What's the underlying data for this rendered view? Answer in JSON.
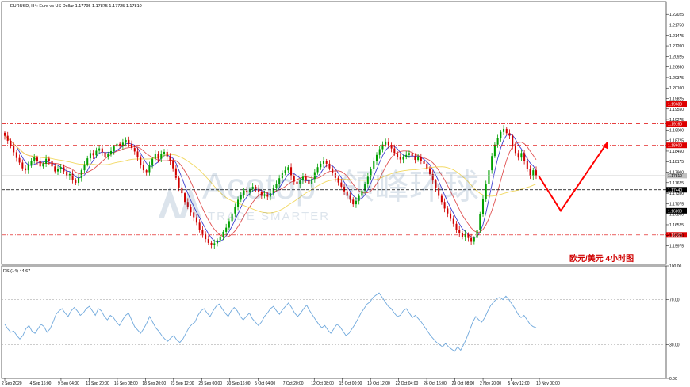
{
  "header": {
    "symbol_line": "EURUSD, H4:  Euro vs US Dollar  1.17795 1.17875 1.17725 1.17810"
  },
  "watermark": {
    "brand": "Acetop",
    "brand_cn": "领峰环球",
    "tagline": "TRADE SMARTER"
  },
  "annotation": "欧元/美元   4小时图",
  "colors": {
    "bull": "#00a000",
    "bear": "#d00000",
    "ma_fast": "#3f3fd0",
    "ma_mid": "#e05050",
    "ma_slow": "#f2d860",
    "rsi": "#6fa8dc",
    "level_red": "#dd0000",
    "level_black": "#000000",
    "arrow": "#ff0000"
  },
  "chart_data": [
    {
      "type": "candlestick",
      "name": "price",
      "ylim": [
        1.1549,
        1.2236
      ],
      "ytick_labels": [
        "1.22025",
        "1.21750",
        "1.21475",
        "1.21200",
        "1.20925",
        "1.20650",
        "1.20375",
        "1.20100",
        "1.19825",
        "1.19550",
        "1.19275",
        "1.19000",
        "1.18725",
        "1.18450",
        "1.18175",
        "1.17900",
        "1.17625",
        "1.17350",
        "1.17075",
        "1.16800",
        "1.16525",
        "1.16250",
        "1.15975"
      ],
      "ytick_values": [
        1.22025,
        1.2175,
        1.21475,
        1.212,
        1.20925,
        1.2065,
        1.20375,
        1.201,
        1.19825,
        1.1955,
        1.19275,
        1.19,
        1.18725,
        1.1845,
        1.18175,
        1.179,
        1.17625,
        1.1735,
        1.17075,
        1.168,
        1.16525,
        1.1625,
        1.15975
      ],
      "current_price": 1.1781,
      "current_price_label": "1.17810",
      "levels": [
        {
          "value": 1.1968,
          "label": "1.19680",
          "style": "red"
        },
        {
          "value": 1.1916,
          "label": "1.19160",
          "style": "red"
        },
        {
          "value": 1.186,
          "label": "1.18600",
          "style": "red"
        },
        {
          "value": 1.1744,
          "label": "1.17440",
          "style": "black"
        },
        {
          "value": 1.1689,
          "label": "1.16890",
          "style": "black"
        },
        {
          "value": 1.1626,
          "label": "1.16260",
          "style": "red"
        }
      ],
      "closes": [
        1.1885,
        1.1872,
        1.1858,
        1.1842,
        1.1827,
        1.1815,
        1.18,
        1.1795,
        1.1808,
        1.182,
        1.1828,
        1.1818,
        1.1805,
        1.1812,
        1.1825,
        1.1818,
        1.1805,
        1.1792,
        1.1798,
        1.1803,
        1.1792,
        1.178,
        1.1785,
        1.177,
        1.1762,
        1.1775,
        1.1795,
        1.181,
        1.1826,
        1.184,
        1.1834,
        1.1846,
        1.1852,
        1.1842,
        1.183,
        1.1838,
        1.1845,
        1.1857,
        1.1864,
        1.1858,
        1.1867,
        1.1874,
        1.1864,
        1.1853,
        1.1844,
        1.1828,
        1.1808,
        1.1795,
        1.179,
        1.1807,
        1.1825,
        1.1838,
        1.1825,
        1.1837,
        1.1843,
        1.1831,
        1.1818,
        1.18,
        1.1775,
        1.175,
        1.1735,
        1.1712,
        1.17,
        1.1685,
        1.1672,
        1.1658,
        1.164,
        1.1628,
        1.1615,
        1.1605,
        1.16,
        1.1604,
        1.1612,
        1.1622,
        1.1634,
        1.1645,
        1.1662,
        1.1682,
        1.17,
        1.1718,
        1.173,
        1.1742,
        1.1737,
        1.1745,
        1.1752,
        1.1746,
        1.1738,
        1.1728,
        1.1732,
        1.1726,
        1.1735,
        1.1748,
        1.176,
        1.1774,
        1.1788,
        1.1795,
        1.1803,
        1.178,
        1.1765,
        1.1758,
        1.1768,
        1.1778,
        1.177,
        1.176,
        1.1772,
        1.179,
        1.1803,
        1.1812,
        1.182,
        1.1812,
        1.18,
        1.1788,
        1.1775,
        1.1763,
        1.1752,
        1.174,
        1.1728,
        1.1718,
        1.1706,
        1.1715,
        1.1728,
        1.1742,
        1.176,
        1.1778,
        1.1798,
        1.1818,
        1.1835,
        1.185,
        1.1862,
        1.187,
        1.1861,
        1.1852,
        1.184,
        1.183,
        1.1823,
        1.183,
        1.1835,
        1.184,
        1.1832,
        1.1822,
        1.183,
        1.182,
        1.1812,
        1.18,
        1.1785,
        1.1768,
        1.1748,
        1.1728,
        1.1712,
        1.1695,
        1.1682,
        1.1668,
        1.1655,
        1.164,
        1.163,
        1.162,
        1.1628,
        1.1618,
        1.1608,
        1.1618,
        1.164,
        1.168,
        1.172,
        1.176,
        1.1795,
        1.1832,
        1.1862,
        1.188,
        1.1895,
        1.1903,
        1.1892,
        1.1885,
        1.186,
        1.184,
        1.1828,
        1.184,
        1.182,
        1.1798,
        1.178,
        1.1795,
        1.1781
      ],
      "x_tick_labels": [
        "2 Sep 2020",
        "4 Sep 16:00",
        "9 Sep 04:00",
        "11 Sep 20:00",
        "16 Sep 08:00",
        "18 Sep 20:00",
        "23 Sep 12:00",
        "28 Sep 00:00",
        "30 Sep 16:00",
        "5 Oct 04:00",
        "7 Oct 20:00",
        "12 Oct 08:00",
        "15 Oct 00:00",
        "19 Oct 12:00",
        "22 Oct 04:00",
        "26 Oct 16:00",
        "29 Oct 08:00",
        "2 Nov 20:00",
        "5 Nov 12:00",
        "10 Nov 00:00"
      ]
    },
    {
      "type": "line",
      "name": "RSI(14)",
      "label": "RSI(14) 44.67",
      "ylim": [
        0,
        100
      ],
      "ytick_labels": [
        "100.00",
        "70.00",
        "30.00",
        "0.00"
      ],
      "ytick_values": [
        100,
        70,
        30,
        0
      ],
      "levels": [
        70,
        30
      ],
      "values": [
        48,
        44,
        41,
        42,
        38,
        35,
        38,
        44,
        47,
        42,
        40,
        44,
        48,
        46,
        41,
        44,
        50,
        57,
        60,
        62,
        58,
        55,
        60,
        63,
        60,
        56,
        58,
        62,
        64,
        60,
        56,
        62,
        60,
        55,
        52,
        56,
        54,
        50,
        47,
        52,
        56,
        58,
        52,
        46,
        43,
        40,
        44,
        49,
        55,
        50,
        45,
        42,
        38,
        35,
        33,
        36,
        38,
        34,
        32,
        35,
        40,
        45,
        48,
        50,
        56,
        60,
        62,
        58,
        55,
        60,
        64,
        66,
        62,
        58,
        55,
        60,
        63,
        60,
        55,
        52,
        55,
        58,
        53,
        50,
        47,
        50,
        55,
        58,
        62,
        64,
        60,
        57,
        61,
        64,
        67,
        63,
        58,
        55,
        58,
        62,
        65,
        60,
        56,
        52,
        48,
        45,
        47,
        43,
        40,
        44,
        48,
        46,
        42,
        38,
        40,
        44,
        48,
        53,
        58,
        62,
        66,
        68,
        72,
        74,
        76,
        72,
        68,
        64,
        62,
        58,
        55,
        56,
        60,
        62,
        58,
        54,
        56,
        53,
        50,
        46,
        42,
        38,
        35,
        32,
        30,
        28,
        31,
        28,
        26,
        24,
        28,
        25,
        30,
        36,
        43,
        50,
        55,
        52,
        50,
        54,
        60,
        65,
        68,
        71,
        72,
        70,
        73,
        70,
        66,
        62,
        57,
        54,
        56,
        52,
        48,
        46,
        45
      ]
    }
  ]
}
